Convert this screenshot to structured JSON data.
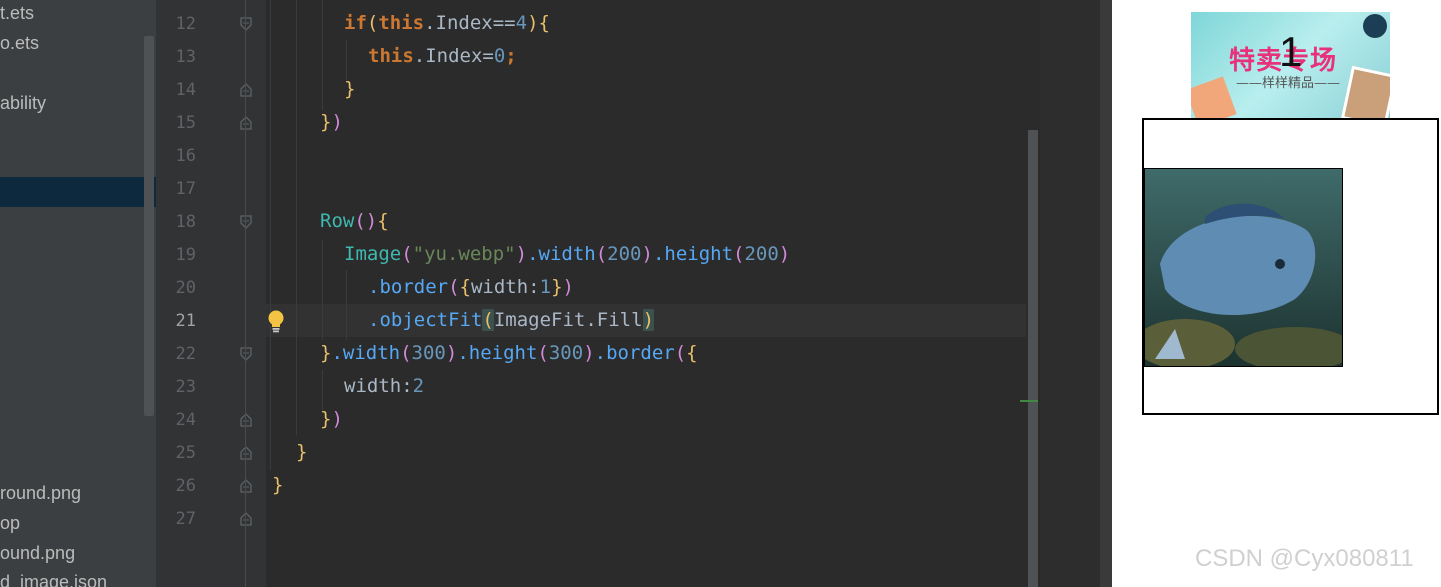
{
  "project_tree": {
    "items": [
      "t.ets",
      "o.ets",
      "ability",
      "round.png",
      "op",
      "ound.png",
      "d_image.json"
    ]
  },
  "editor": {
    "line_numbers": [
      "12",
      "13",
      "14",
      "15",
      "16",
      "17",
      "18",
      "19",
      "20",
      "21",
      "22",
      "23",
      "24",
      "25",
      "26",
      "27"
    ],
    "current_line": "21",
    "lines": {
      "l12": {
        "a": "if",
        "b": "(",
        "c": "this",
        "d": ".Index==",
        "e": "4",
        "f": ")",
        "g": "{"
      },
      "l13": {
        "a": "this",
        "b": ".Index=",
        "c": "0",
        "d": ";"
      },
      "l14": {
        "a": "}"
      },
      "l15": {
        "a": "}",
        "b": ")"
      },
      "l18": {
        "a": "Row",
        "b": "()",
        "c": "{"
      },
      "l19": {
        "a": "Image",
        "b": "(",
        "c": "\"yu.webp\"",
        "d": ")",
        "e": ".width",
        "f": "(",
        "g": "200",
        "h": ")",
        "i": ".height",
        "j": "(",
        "k": "200",
        "l": ")"
      },
      "l20": {
        "a": ".border",
        "b": "(",
        "c": "{",
        "d": "width:",
        "e": "1",
        "f": "}",
        "g": ")"
      },
      "l21": {
        "a": ".objectFit",
        "b": "(",
        "c": "ImageFit.Fill",
        "d": ")"
      },
      "l22": {
        "a": "}",
        "b": ".width",
        "c": "(",
        "d": "300",
        "e": ")",
        "f": ".height",
        "g": "(",
        "h": "300",
        "i": ")",
        "j": ".border",
        "k": "(",
        "l": "{"
      },
      "l23": {
        "a": "width:",
        "b": "2"
      },
      "l24": {
        "a": "}",
        "b": ")"
      },
      "l25": {
        "a": "}"
      },
      "l26": {
        "a": "}"
      }
    }
  },
  "preview": {
    "banner_title": "特卖专场",
    "banner_subtitle": "——样样精品——",
    "index_value": "1",
    "watermark": "CSDN @Cyx080811"
  },
  "colors": {
    "keyword": "#cc7832",
    "function": "#56a8f5",
    "number": "#6897bb",
    "string": "#6a8759",
    "background": "#2b2b2b",
    "preview_bg": "#ffffff"
  }
}
